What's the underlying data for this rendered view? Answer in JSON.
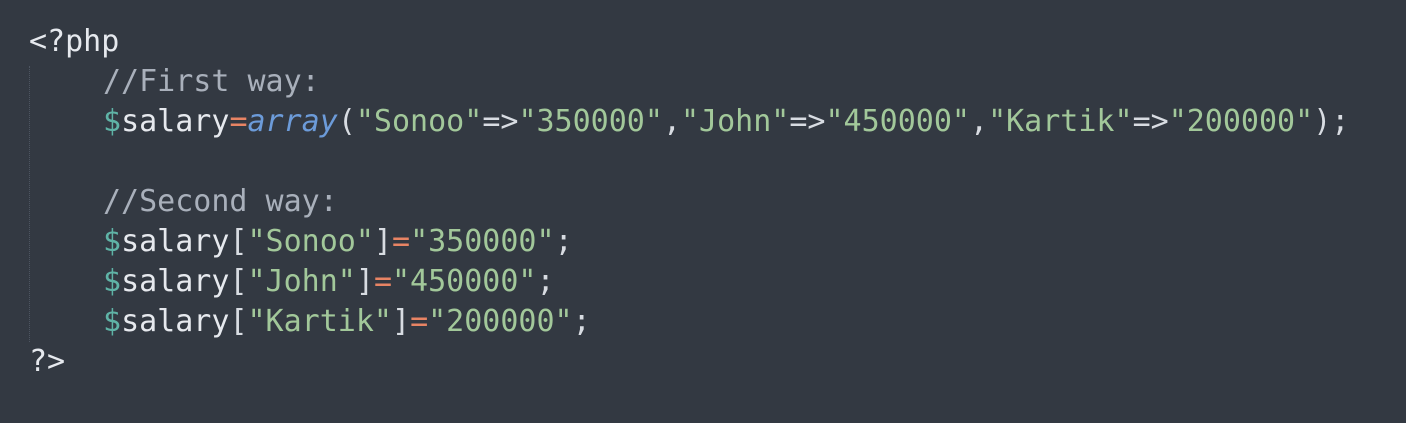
{
  "theme": {
    "background": "#333942",
    "default": "#e6e9ee",
    "comment": "#a9b0bb",
    "variable": "#5fb3a6",
    "operator": "#e88464",
    "function": "#6c9bd9",
    "string": "#a2c89a"
  },
  "lines": [
    {
      "indent": false,
      "tokens": [
        {
          "t": "<?php",
          "k": "default"
        }
      ]
    },
    {
      "indent": true,
      "tokens": [
        {
          "t": "//First way:",
          "k": "comment"
        }
      ]
    },
    {
      "indent": true,
      "tokens": [
        {
          "t": "$",
          "k": "var"
        },
        {
          "t": "salary",
          "k": "default"
        },
        {
          "t": "=",
          "k": "op"
        },
        {
          "t": "array",
          "k": "fn"
        },
        {
          "t": "(",
          "k": "punc"
        },
        {
          "t": "\"Sonoo\"",
          "k": "str"
        },
        {
          "t": "=>",
          "k": "punc"
        },
        {
          "t": "\"350000\"",
          "k": "str"
        },
        {
          "t": ",",
          "k": "punc"
        },
        {
          "t": "\"John\"",
          "k": "str"
        },
        {
          "t": "=>",
          "k": "punc"
        },
        {
          "t": "\"450000\"",
          "k": "str"
        },
        {
          "t": ",",
          "k": "punc"
        },
        {
          "t": "\"Kartik\"",
          "k": "str"
        },
        {
          "t": "=>",
          "k": "punc"
        },
        {
          "t": "\"200000\"",
          "k": "str"
        },
        {
          "t": ");",
          "k": "punc"
        }
      ]
    },
    {
      "indent": true,
      "tokens": []
    },
    {
      "indent": true,
      "tokens": [
        {
          "t": "//Second way:",
          "k": "comment"
        }
      ]
    },
    {
      "indent": true,
      "tokens": [
        {
          "t": "$",
          "k": "var"
        },
        {
          "t": "salary",
          "k": "default"
        },
        {
          "t": "[",
          "k": "punc"
        },
        {
          "t": "\"Sonoo\"",
          "k": "str"
        },
        {
          "t": "]",
          "k": "punc"
        },
        {
          "t": "=",
          "k": "op"
        },
        {
          "t": "\"350000\"",
          "k": "str"
        },
        {
          "t": ";",
          "k": "punc"
        }
      ]
    },
    {
      "indent": true,
      "tokens": [
        {
          "t": "$",
          "k": "var"
        },
        {
          "t": "salary",
          "k": "default"
        },
        {
          "t": "[",
          "k": "punc"
        },
        {
          "t": "\"John\"",
          "k": "str"
        },
        {
          "t": "]",
          "k": "punc"
        },
        {
          "t": "=",
          "k": "op"
        },
        {
          "t": "\"450000\"",
          "k": "str"
        },
        {
          "t": ";",
          "k": "punc"
        }
      ]
    },
    {
      "indent": true,
      "tokens": [
        {
          "t": "$",
          "k": "var"
        },
        {
          "t": "salary",
          "k": "default"
        },
        {
          "t": "[",
          "k": "punc"
        },
        {
          "t": "\"Kartik\"",
          "k": "str"
        },
        {
          "t": "]",
          "k": "punc"
        },
        {
          "t": "=",
          "k": "op"
        },
        {
          "t": "\"200000\"",
          "k": "str"
        },
        {
          "t": ";",
          "k": "punc"
        }
      ]
    },
    {
      "indent": false,
      "tokens": [
        {
          "t": "?>",
          "k": "default"
        }
      ]
    }
  ]
}
